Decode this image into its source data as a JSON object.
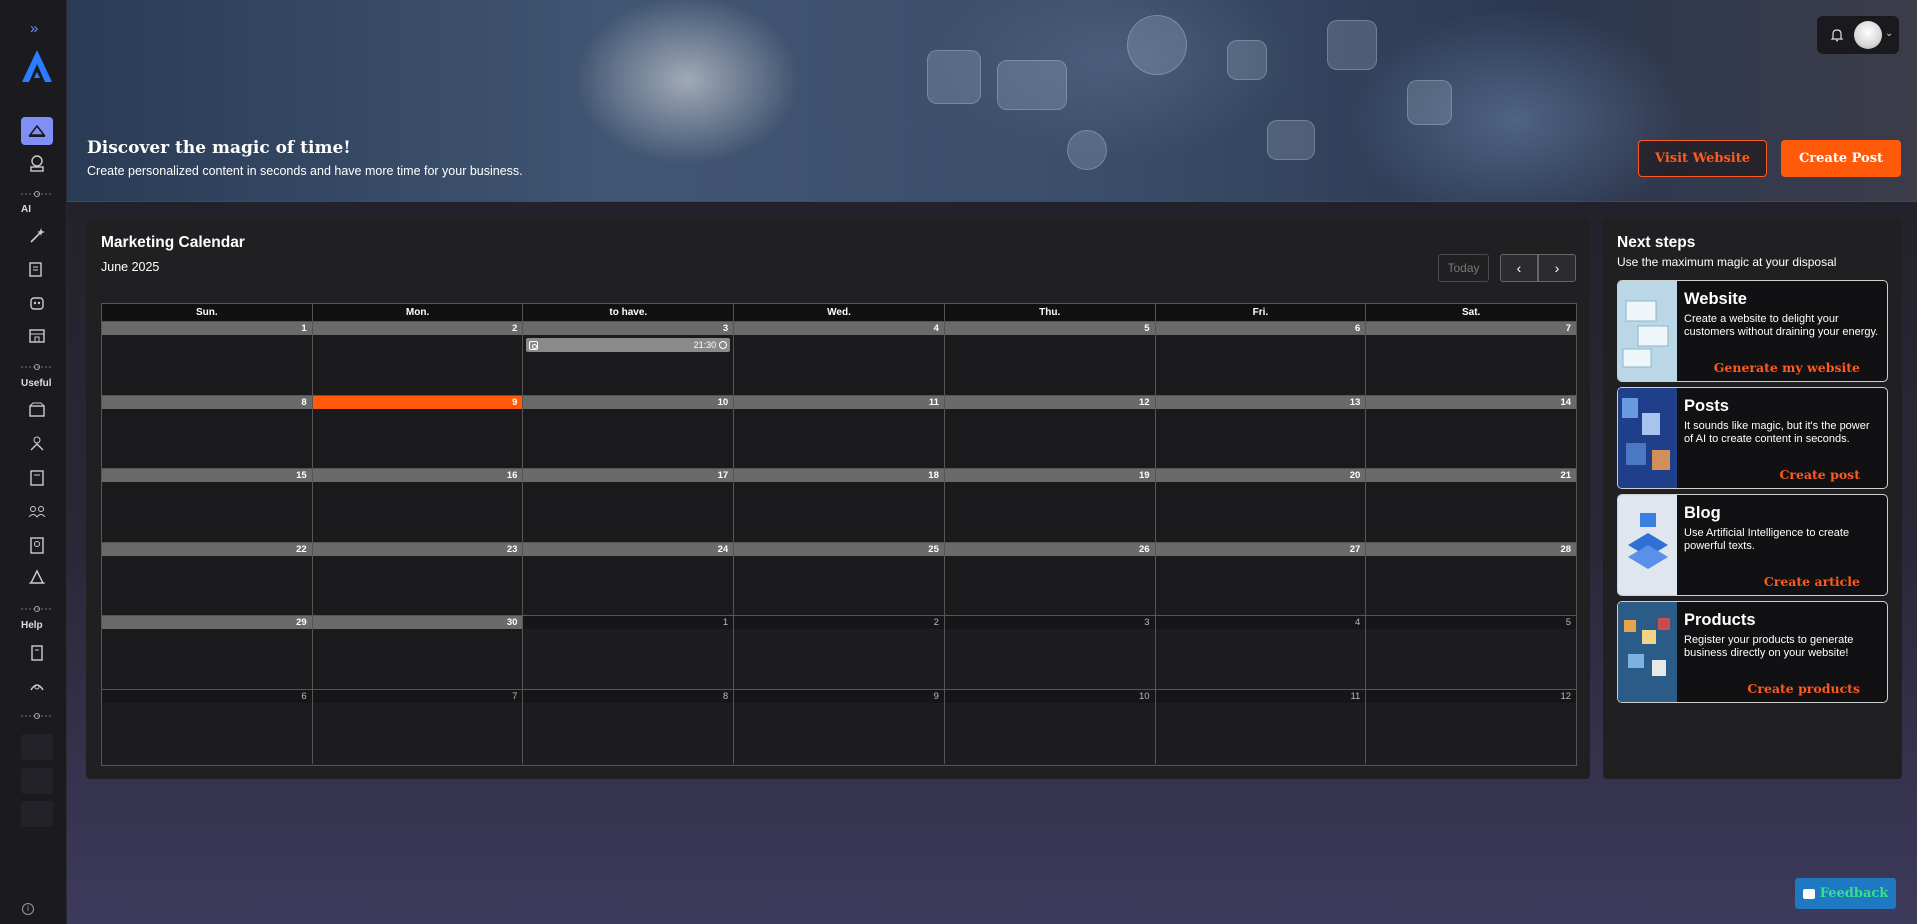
{
  "sidebar": {
    "sections": {
      "ai": "AI",
      "useful": "Useful",
      "help": "Help"
    },
    "info_icon": "i"
  },
  "banner": {
    "title": "Discover the magic of time!",
    "subtitle": "Create personalized content in seconds and have more time for your business.",
    "visit_label": "Visit Website",
    "create_label": "Create Post"
  },
  "calendar": {
    "title": "Marketing Calendar",
    "month": "June 2025",
    "today_label": "Today",
    "prev_icon": "‹",
    "next_icon": "›",
    "weekdays": [
      "Sun.",
      "Mon.",
      "to have.",
      "Wed.",
      "Thu.",
      "Fri.",
      "Sat."
    ],
    "weeks": [
      [
        {
          "d": "1"
        },
        {
          "d": "2"
        },
        {
          "d": "3",
          "event": "21:30"
        },
        {
          "d": "4"
        },
        {
          "d": "5"
        },
        {
          "d": "6"
        },
        {
          "d": "7"
        }
      ],
      [
        {
          "d": "8"
        },
        {
          "d": "9",
          "today": true
        },
        {
          "d": "10"
        },
        {
          "d": "11"
        },
        {
          "d": "12"
        },
        {
          "d": "13"
        },
        {
          "d": "14"
        }
      ],
      [
        {
          "d": "15"
        },
        {
          "d": "16"
        },
        {
          "d": "17"
        },
        {
          "d": "18"
        },
        {
          "d": "19"
        },
        {
          "d": "20"
        },
        {
          "d": "21"
        }
      ],
      [
        {
          "d": "22"
        },
        {
          "d": "23"
        },
        {
          "d": "24"
        },
        {
          "d": "25"
        },
        {
          "d": "26"
        },
        {
          "d": "27"
        },
        {
          "d": "28"
        }
      ],
      [
        {
          "d": "29"
        },
        {
          "d": "30"
        },
        {
          "d": "1",
          "other": true
        },
        {
          "d": "2",
          "other": true
        },
        {
          "d": "3",
          "other": true
        },
        {
          "d": "4",
          "other": true
        },
        {
          "d": "5",
          "other": true
        }
      ],
      [
        {
          "d": "6",
          "other": true
        },
        {
          "d": "7",
          "other": true
        },
        {
          "d": "8",
          "other": true
        },
        {
          "d": "9",
          "other": true
        },
        {
          "d": "10",
          "other": true
        },
        {
          "d": "11",
          "other": true
        },
        {
          "d": "12",
          "other": true
        }
      ]
    ]
  },
  "next_steps": {
    "title": "Next steps",
    "subtitle": "Use the maximum magic at your disposal",
    "cards": [
      {
        "title": "Website",
        "desc": "Create a website to delight your customers without draining your energy.",
        "link": "Generate my website"
      },
      {
        "title": "Posts",
        "desc": "It sounds like magic, but it's the power of AI to create content in seconds.",
        "link": "Create post"
      },
      {
        "title": "Blog",
        "desc": "Use Artificial Intelligence to create powerful texts.",
        "link": "Create article"
      },
      {
        "title": "Products",
        "desc": "Register your products to generate business directly on your website!",
        "link": "Create products"
      }
    ]
  },
  "feedback_label": "Feedback",
  "colors": {
    "accent": "#ff5a0a",
    "sidebar_active": "#7e8ff5",
    "feedback_bg": "#1f78c2",
    "feedback_text": "#35e08a"
  }
}
